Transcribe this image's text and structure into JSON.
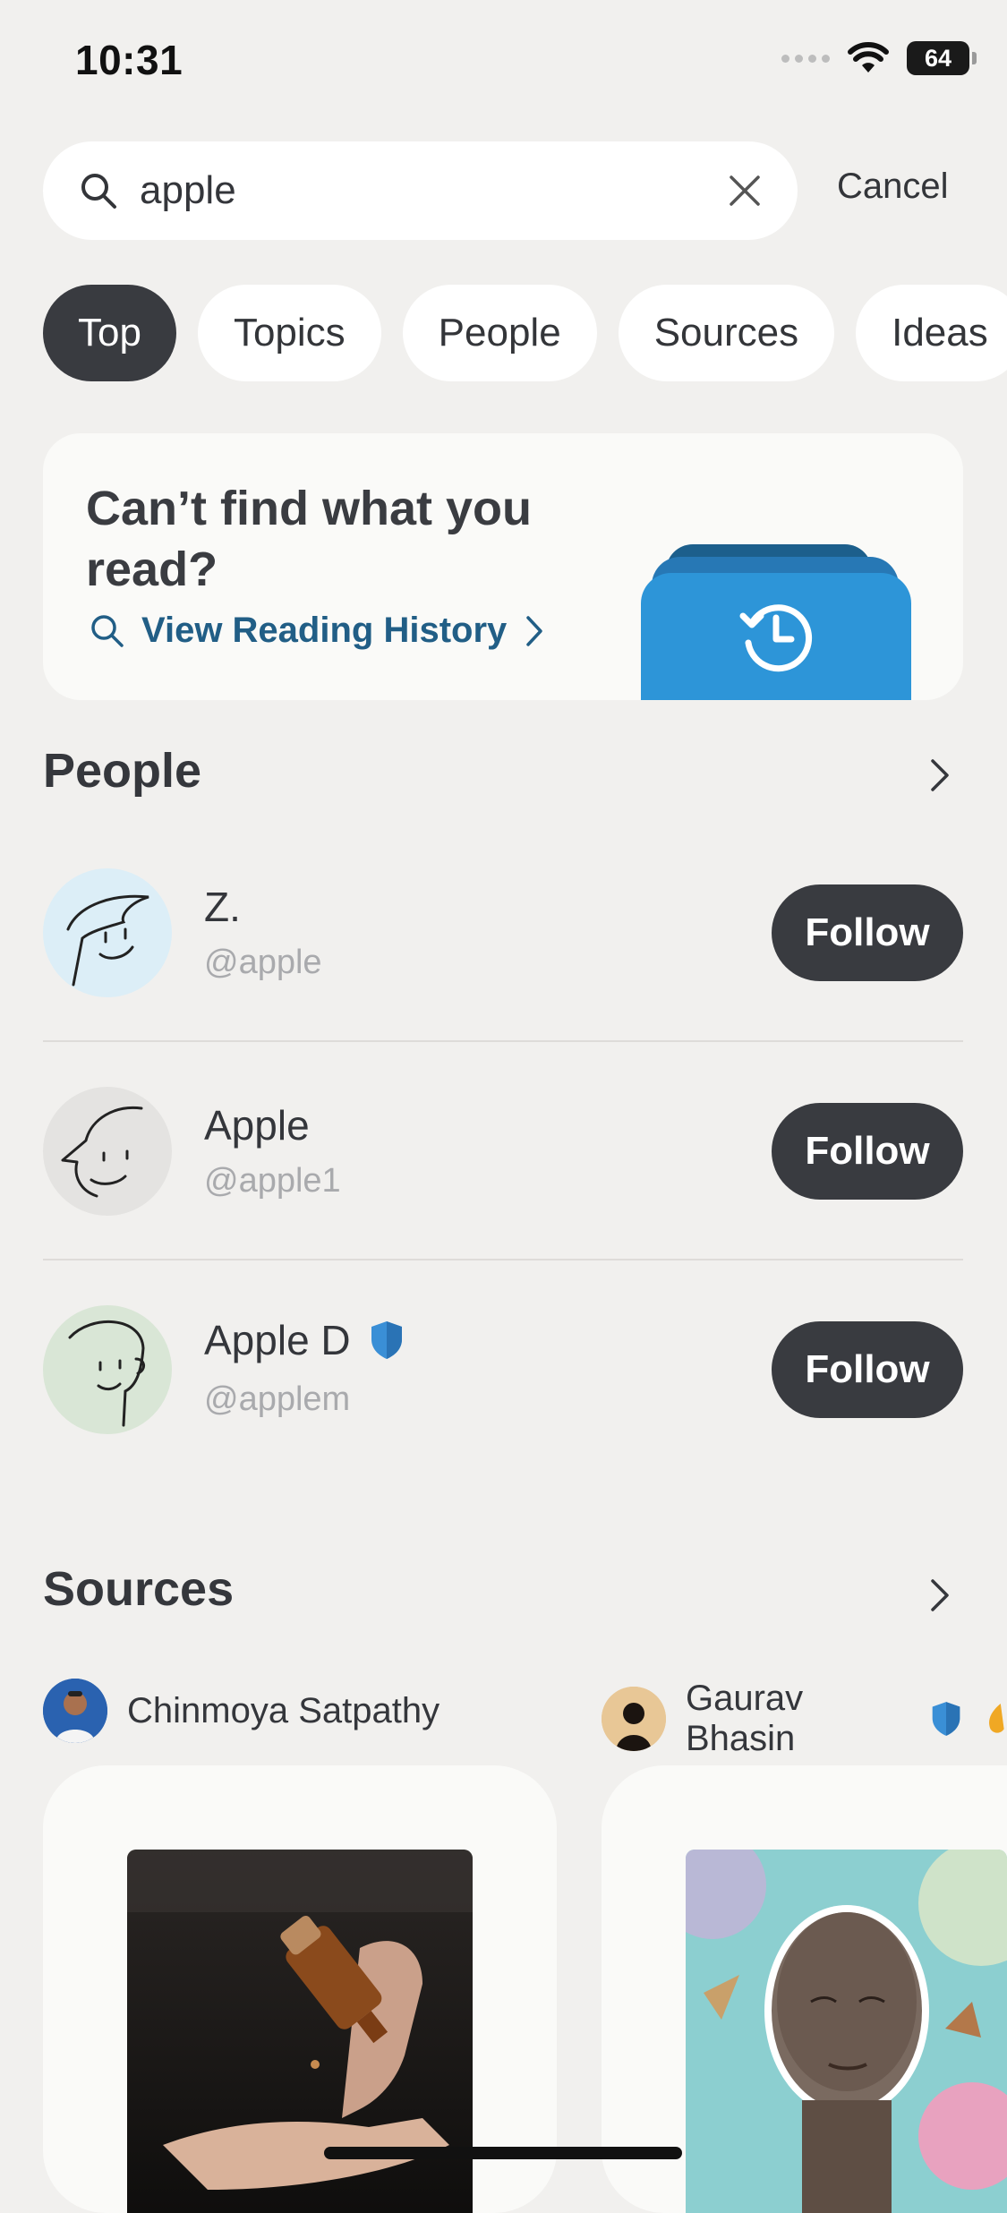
{
  "status_bar": {
    "time": "10:31",
    "battery": "64"
  },
  "search": {
    "query": "apple",
    "cancel_label": "Cancel"
  },
  "filters": [
    "Top",
    "Topics",
    "People",
    "Sources",
    "Ideas"
  ],
  "history_card": {
    "title": "Can’t find what you read?",
    "link_label": "View Reading History"
  },
  "people": {
    "title": "People",
    "items": [
      {
        "name": "Z.",
        "handle": "@apple",
        "follow_label": "Follow",
        "verified": false
      },
      {
        "name": "Apple",
        "handle": "@apple1",
        "follow_label": "Follow",
        "verified": false
      },
      {
        "name": "Apple D",
        "handle": "@applem",
        "follow_label": "Follow",
        "verified": true
      }
    ]
  },
  "sources": {
    "title": "Sources",
    "items": [
      {
        "author": "Chinmoya Satpathy",
        "verified": false
      },
      {
        "author": "Gaurav Bhasin",
        "verified": true
      }
    ]
  },
  "colors": {
    "accent": "#215e86",
    "button_dark": "#393b40",
    "verified_blue": "#3a8fd6",
    "background": "#f1f0ee"
  },
  "icons": [
    "search-icon",
    "clear-icon",
    "history-icon",
    "chevron-right-icon",
    "verified-badge-icon",
    "wifi-icon"
  ]
}
